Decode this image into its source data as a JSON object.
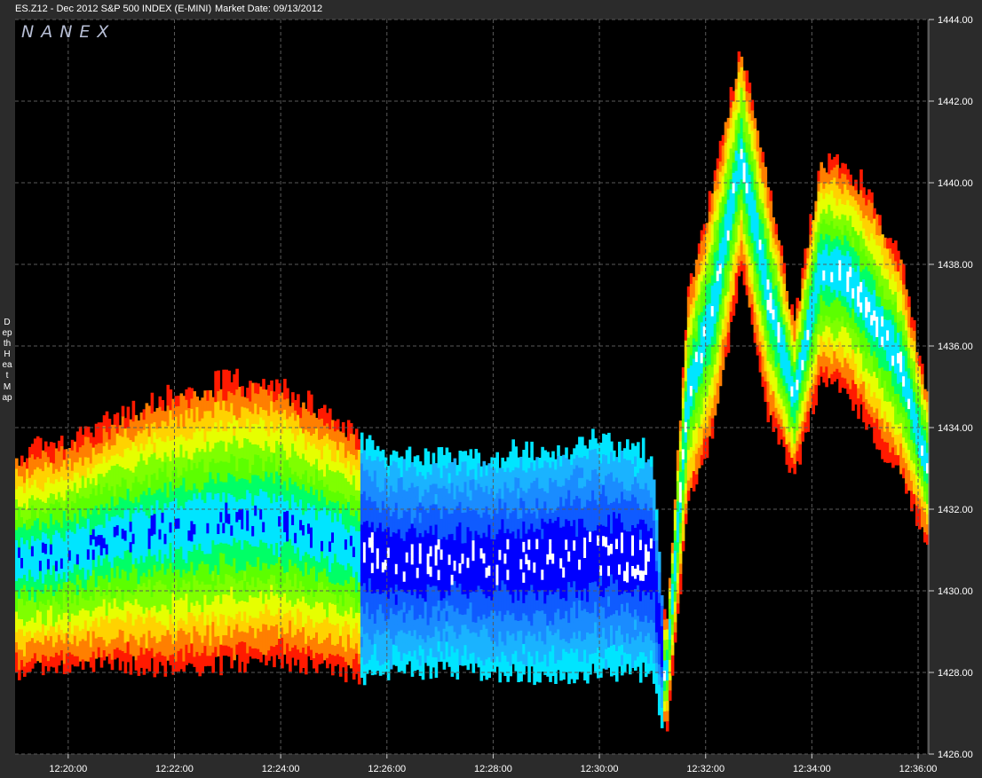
{
  "header": {
    "title": "ES.Z12 - Dec 2012 S&P 500 INDEX (E-MINI)",
    "market_date": "Market Date: 09/13/2012"
  },
  "logo": "NANEX",
  "side_label": "Depth Heat Map",
  "colors": {
    "background": "#000000",
    "frame": "#2b2b2b",
    "grid": "#5a5a5a",
    "heat_scale": [
      "#0000ff",
      "#1a8cff",
      "#00e5ff",
      "#00ff66",
      "#7fff00",
      "#e6ff00",
      "#ffd200",
      "#ff7f00",
      "#ff1a00"
    ]
  },
  "chart_data": {
    "type": "heatmap",
    "title": "",
    "xlabel": "",
    "ylabel": "",
    "x_range": [
      "12:19:00",
      "12:36:10"
    ],
    "x_ticks": [
      "12:20:00",
      "12:22:00",
      "12:24:00",
      "12:26:00",
      "12:28:00",
      "12:30:00",
      "12:32:00",
      "12:34:00",
      "12:36:00"
    ],
    "y_range": [
      1426.0,
      1444.0
    ],
    "y_ticks": [
      "1444.00",
      "1442.00",
      "1440.00",
      "1438.00",
      "1436.00",
      "1434.00",
      "1432.00",
      "1430.00",
      "1428.00",
      "1426.00"
    ],
    "grid": true,
    "y_axis_position": "right",
    "price_path": [
      {
        "t": "12:19:00",
        "mid": 1430.6,
        "half": 2.6
      },
      {
        "t": "12:20:00",
        "mid": 1430.8,
        "half": 2.7
      },
      {
        "t": "12:21:00",
        "mid": 1431.2,
        "half": 3.0
      },
      {
        "t": "12:22:00",
        "mid": 1431.4,
        "half": 3.3
      },
      {
        "t": "12:23:00",
        "mid": 1431.6,
        "half": 3.4
      },
      {
        "t": "12:24:00",
        "mid": 1431.6,
        "half": 3.3
      },
      {
        "t": "12:25:00",
        "mid": 1431.1,
        "half": 3.0
      },
      {
        "t": "12:25:30",
        "mid": 1430.8,
        "half": 2.9
      },
      {
        "t": "12:26:00",
        "mid": 1430.6,
        "half": 2.6
      },
      {
        "t": "12:27:00",
        "mid": 1430.6,
        "half": 2.5
      },
      {
        "t": "12:28:00",
        "mid": 1430.6,
        "half": 2.6
      },
      {
        "t": "12:29:00",
        "mid": 1430.6,
        "half": 2.7
      },
      {
        "t": "12:30:00",
        "mid": 1430.8,
        "half": 2.8
      },
      {
        "t": "12:31:00",
        "mid": 1430.6,
        "half": 2.6
      },
      {
        "t": "12:31:15",
        "mid": 1427.6,
        "half": 1.2
      },
      {
        "t": "12:31:40",
        "mid": 1434.6,
        "half": 2.5
      },
      {
        "t": "12:32:10",
        "mid": 1437.0,
        "half": 3.0
      },
      {
        "t": "12:32:40",
        "mid": 1440.6,
        "half": 2.6
      },
      {
        "t": "12:33:10",
        "mid": 1437.2,
        "half": 2.8
      },
      {
        "t": "12:33:40",
        "mid": 1434.6,
        "half": 1.8
      },
      {
        "t": "12:34:10",
        "mid": 1437.8,
        "half": 2.6
      },
      {
        "t": "12:34:40",
        "mid": 1437.6,
        "half": 2.7
      },
      {
        "t": "12:35:10",
        "mid": 1436.6,
        "half": 2.8
      },
      {
        "t": "12:35:40",
        "mid": 1435.4,
        "half": 2.6
      },
      {
        "t": "12:36:10",
        "mid": 1433.0,
        "half": 1.8
      }
    ]
  }
}
